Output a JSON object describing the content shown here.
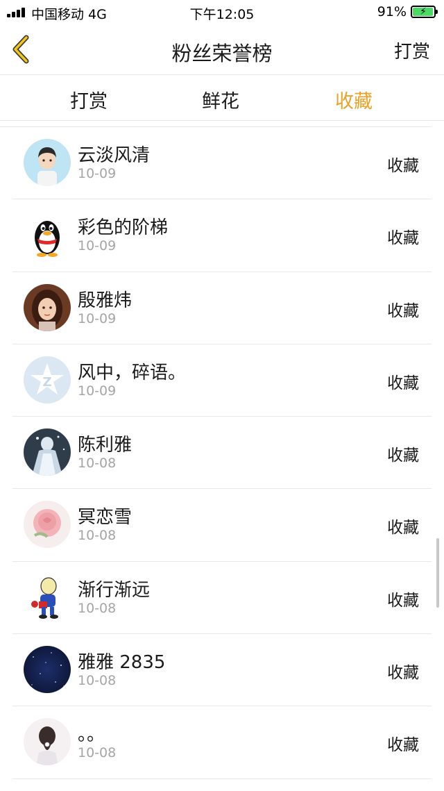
{
  "status_bar": {
    "carrier": "中国移动 4G",
    "time": "下午12:05",
    "battery": "91%"
  },
  "nav": {
    "title": "粉丝荣誉榜",
    "right_label": "打赏",
    "back_icon": "chevron-left-icon"
  },
  "tabs": [
    {
      "label": "打赏",
      "active": false
    },
    {
      "label": "鲜花",
      "active": false
    },
    {
      "label": "收藏",
      "active": true
    }
  ],
  "accent_color": "#e9a228",
  "fans": [
    {
      "name": "云淡风清",
      "date": "10-09",
      "action": "收藏",
      "avatar": "cartoon-boy-avatar"
    },
    {
      "name": "彩色的阶梯",
      "date": "10-09",
      "action": "收藏",
      "avatar": "qq-penguin-avatar"
    },
    {
      "name": "殷雅炜",
      "date": "10-09",
      "action": "收藏",
      "avatar": "girl-portrait-avatar"
    },
    {
      "name": "风中，碎语。",
      "date": "10-09",
      "action": "收藏",
      "avatar": "qzone-star-avatar"
    },
    {
      "name": "陈利雅",
      "date": "10-08",
      "action": "收藏",
      "avatar": "princess-avatar"
    },
    {
      "name": "冥恋雪",
      "date": "10-08",
      "action": "收藏",
      "avatar": "rose-avatar"
    },
    {
      "name": "渐行渐远",
      "date": "10-08",
      "action": "收藏",
      "avatar": "cartoon-character-avatar"
    },
    {
      "name": "雅雅 2835",
      "date": "10-08",
      "action": "收藏",
      "avatar": "night-sky-avatar"
    },
    {
      "name": "。。",
      "date": "10-08",
      "action": "收藏",
      "avatar": "girl-back-avatar"
    }
  ]
}
